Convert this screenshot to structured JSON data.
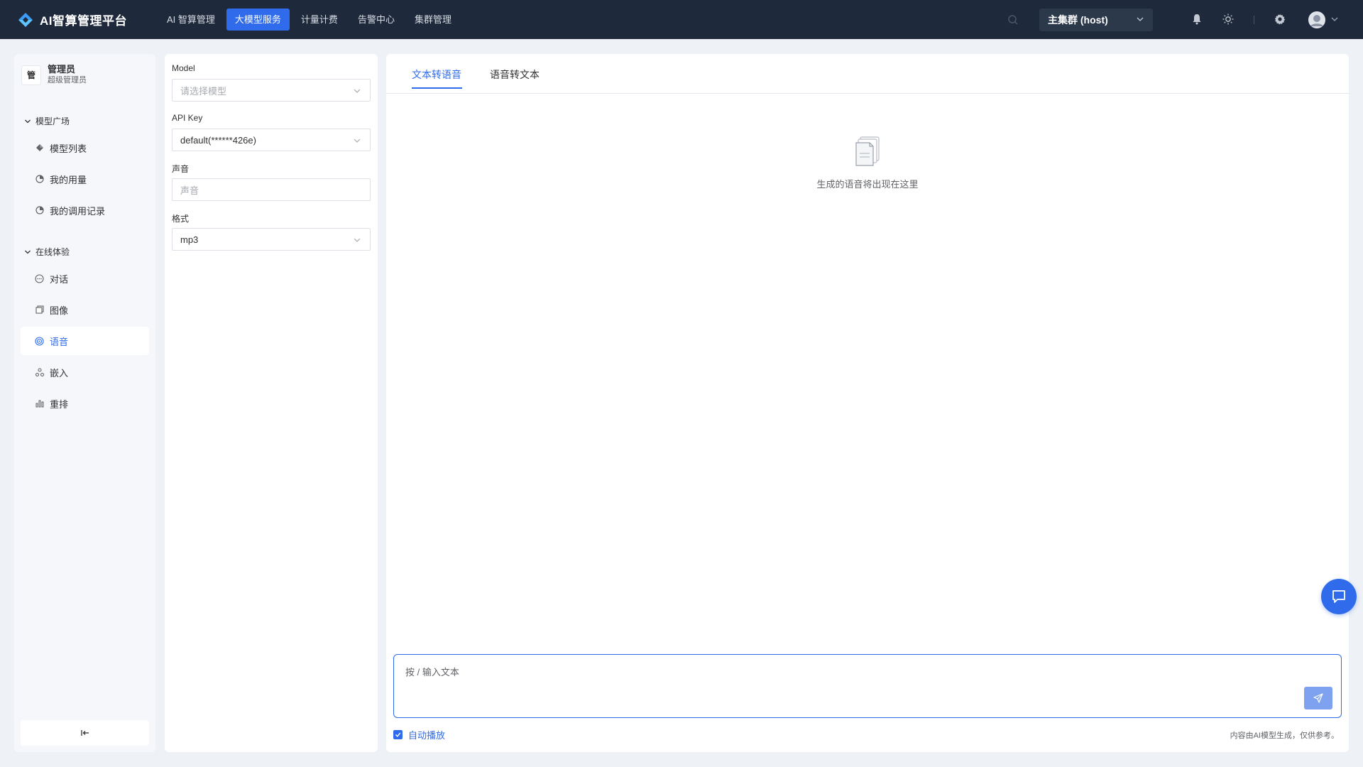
{
  "app": {
    "title": "AI智算管理平台",
    "logo_icon": "platform-logo-icon"
  },
  "nav": {
    "items": [
      {
        "label": "AI 智算管理",
        "active": false
      },
      {
        "label": "大模型服务",
        "active": true
      },
      {
        "label": "计量计费",
        "active": false
      },
      {
        "label": "告警中心",
        "active": false
      },
      {
        "label": "集群管理",
        "active": false
      }
    ]
  },
  "topbar": {
    "cluster": "主集群 (host)",
    "icons": [
      "search-icon",
      "bell-icon",
      "sun-icon",
      "gear-icon",
      "avatar-icon"
    ]
  },
  "user": {
    "badge": "管",
    "name": "管理员",
    "role": "超级管理员"
  },
  "sidebar": {
    "groups": [
      {
        "title": "模型广场",
        "items": [
          {
            "label": "模型列表",
            "icon": "cube-icon",
            "active": false
          },
          {
            "label": "我的用量",
            "icon": "chart-icon",
            "active": false
          },
          {
            "label": "我的调用记录",
            "icon": "record-icon",
            "active": false
          }
        ]
      },
      {
        "title": "在线体验",
        "items": [
          {
            "label": "对话",
            "icon": "chat-icon",
            "active": false
          },
          {
            "label": "图像",
            "icon": "image-icon",
            "active": false
          },
          {
            "label": "语音",
            "icon": "audio-icon",
            "active": true
          },
          {
            "label": "嵌入",
            "icon": "embed-icon",
            "active": false
          },
          {
            "label": "重排",
            "icon": "rerank-icon",
            "active": false
          }
        ]
      }
    ],
    "collapse_icon": "collapse-icon"
  },
  "settings": {
    "model_label": "Model",
    "model_placeholder": "请选择模型",
    "apikey_label": "API Key",
    "apikey_value": "default(******426e)",
    "voice_label": "声音",
    "voice_placeholder": "声音",
    "format_label": "格式",
    "format_value": "mp3"
  },
  "main": {
    "tabs": [
      {
        "label": "文本转语音",
        "active": true
      },
      {
        "label": "语音转文本",
        "active": false
      }
    ],
    "empty_text": "生成的语音将出现在这里",
    "input_placeholder": "按 / 输入文本",
    "autoplay_label": "自动播放",
    "autoplay_checked": true,
    "disclaimer": "内容由AI模型生成，仅供参考。"
  },
  "colors": {
    "accent": "#2f6bea",
    "topbar": "#1e2a3b",
    "background": "#eef1f5"
  }
}
